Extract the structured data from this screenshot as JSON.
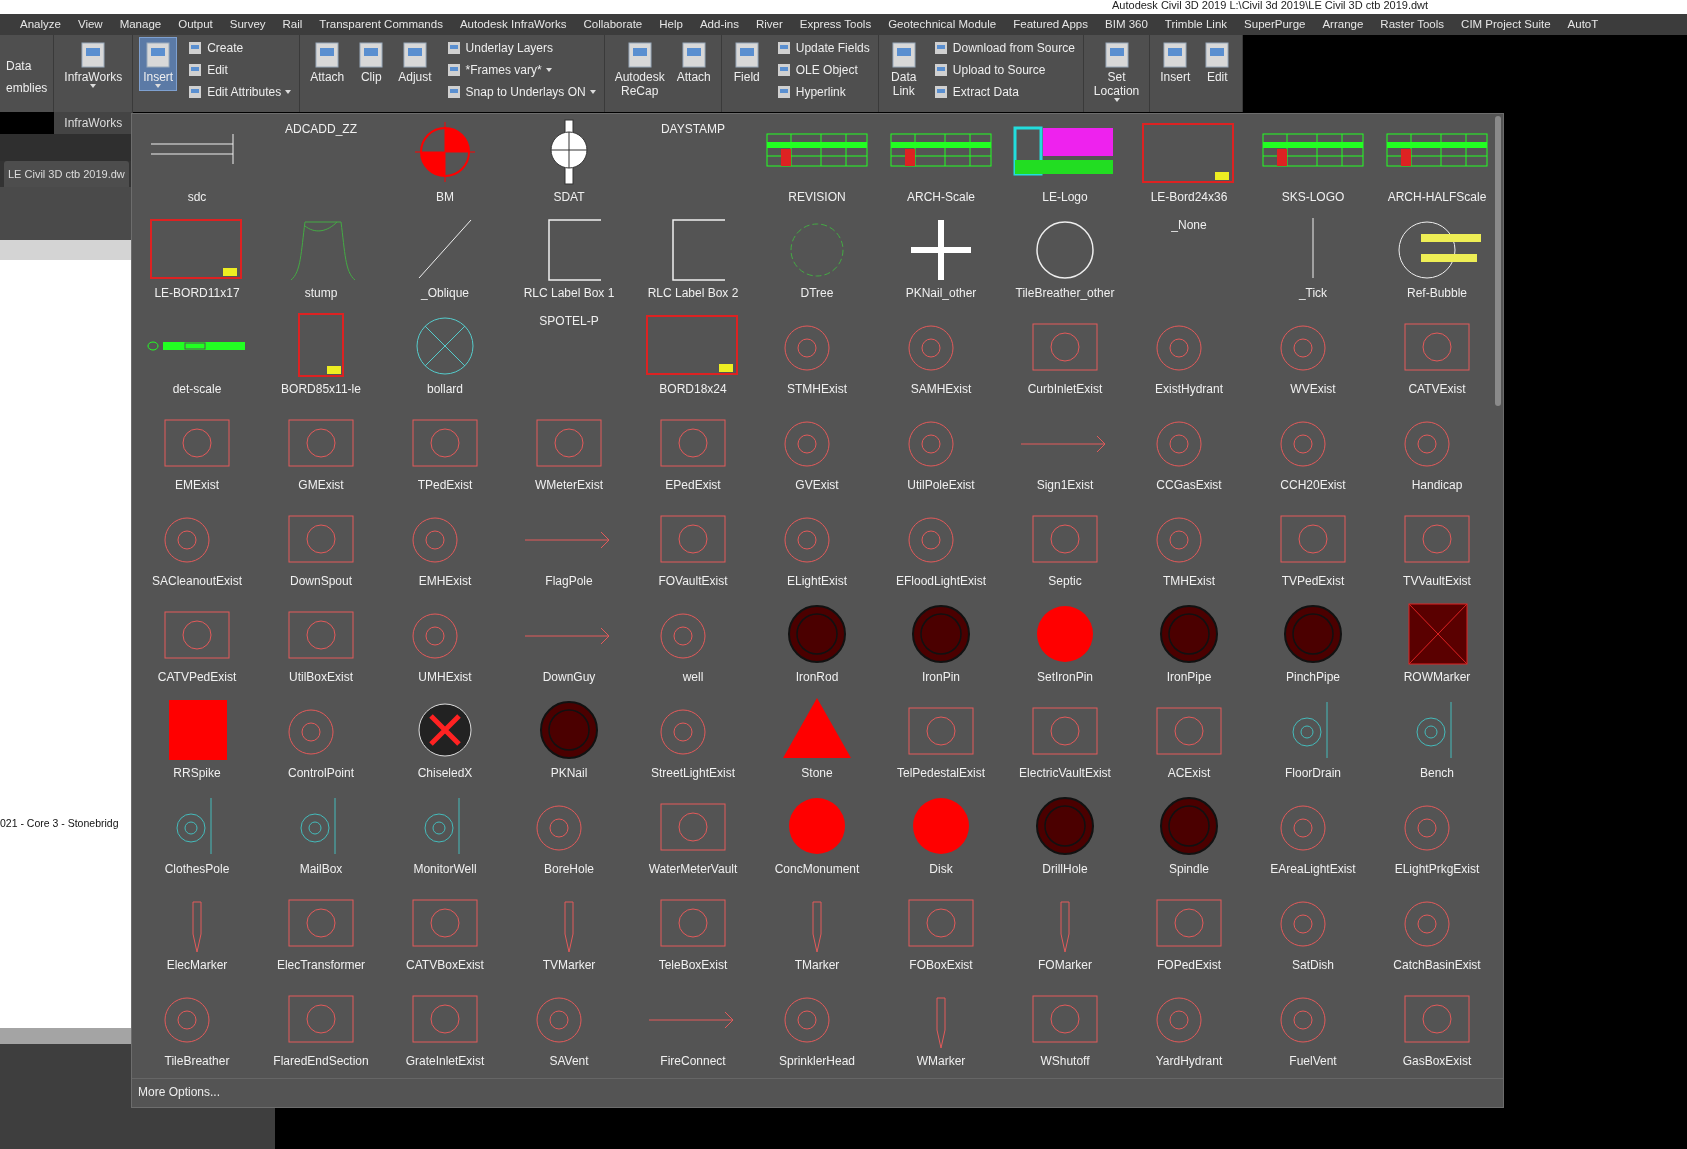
{
  "title_bar": {
    "title": "Autodesk Civil 3D 2019    L:\\Civil 3d 2019\\LE Civil 3D ctb 2019.dwt"
  },
  "ribbon_tabs": [
    "Analyze",
    "View",
    "Manage",
    "Output",
    "Survey",
    "Rail",
    "Transparent Commands",
    "Autodesk InfraWorks",
    "Collaborate",
    "Help",
    "Add-ins",
    "River",
    "Express Tools",
    "Geotechnical Module",
    "Featured Apps",
    "BIM 360",
    "Trimble Link",
    "SuperPurge",
    "Arrange",
    "Raster Tools",
    "CIM Project Suite",
    "AutoT"
  ],
  "ribbon_panels": [
    {
      "groups": [
        {
          "kind": "text",
          "items": [
            {
              "label": "Data"
            },
            {
              "label": "emblies"
            }
          ]
        }
      ]
    },
    {
      "label": "InfraWorks",
      "groups": [
        {
          "kind": "large",
          "items": [
            {
              "label": "InfraWorks",
              "dropdown": true,
              "open": false
            }
          ]
        }
      ]
    },
    {
      "groups": [
        {
          "kind": "large",
          "items": [
            {
              "label": "Insert",
              "dropdown": true,
              "open": true
            }
          ]
        },
        {
          "kind": "stack",
          "items": [
            {
              "label": "Create",
              "dropdown": false
            },
            {
              "label": "Edit",
              "dropdown": false
            },
            {
              "label": "Edit Attributes",
              "dropdown": true
            }
          ]
        }
      ]
    },
    {
      "groups": [
        {
          "kind": "large",
          "items": [
            {
              "label": "Attach",
              "dropdown": false,
              "open": false
            },
            {
              "label": "Clip",
              "dropdown": false,
              "open": false
            },
            {
              "label": "Adjust",
              "dropdown": false,
              "open": false
            }
          ]
        },
        {
          "kind": "stack",
          "items": [
            {
              "label": "Underlay Layers",
              "dropdown": false
            },
            {
              "label": "*Frames vary*",
              "dropdown": true
            },
            {
              "label": "Snap to Underlays ON",
              "dropdown": true
            }
          ]
        }
      ]
    },
    {
      "groups": [
        {
          "kind": "large",
          "items": [
            {
              "label": "Autodesk\nReCap",
              "dropdown": false,
              "open": false
            },
            {
              "label": "Attach",
              "dropdown": false,
              "open": false
            }
          ]
        }
      ]
    },
    {
      "groups": [
        {
          "kind": "large",
          "items": [
            {
              "label": "Field",
              "dropdown": false,
              "open": false
            }
          ]
        },
        {
          "kind": "stack",
          "items": [
            {
              "label": "Update Fields",
              "dropdown": false
            },
            {
              "label": "OLE Object",
              "dropdown": false
            },
            {
              "label": "Hyperlink",
              "dropdown": false
            }
          ]
        }
      ]
    },
    {
      "groups": [
        {
          "kind": "large",
          "items": [
            {
              "label": "Data\nLink",
              "dropdown": false,
              "open": false
            }
          ]
        },
        {
          "kind": "stack",
          "items": [
            {
              "label": "Download from Source",
              "dropdown": false
            },
            {
              "label": "Upload to Source",
              "dropdown": false
            },
            {
              "label": "Extract  Data",
              "dropdown": false
            }
          ]
        }
      ]
    },
    {
      "groups": [
        {
          "kind": "large",
          "items": [
            {
              "label": "Set\nLocation",
              "dropdown": true,
              "open": false
            }
          ]
        }
      ]
    },
    {
      "groups": [
        {
          "kind": "large",
          "items": [
            {
              "label": "Insert",
              "dropdown": false,
              "open": false
            },
            {
              "label": "Edit",
              "dropdown": false,
              "open": false
            }
          ]
        }
      ]
    }
  ],
  "document_tab": {
    "label": "LE Civil 3D ctb 2019.dw"
  },
  "drawing_text": "021 - Core 3 - Stonebridg",
  "gallery": {
    "blocks": [
      {
        "label": "sdc",
        "kind": "rule"
      },
      {
        "label": "ADCADD_ZZ",
        "kind": "none"
      },
      {
        "label": "BM",
        "kind": "target"
      },
      {
        "label": "SDAT",
        "kind": "survey"
      },
      {
        "label": "DAYSTAMP",
        "kind": "none"
      },
      {
        "label": "REVISION",
        "kind": "sheet"
      },
      {
        "label": "ARCH-Scale",
        "kind": "sheet"
      },
      {
        "label": "LE-Logo",
        "kind": "logo"
      },
      {
        "label": "LE-Bord24x36",
        "kind": "border"
      },
      {
        "label": "SKS-LOGO",
        "kind": "sheet"
      },
      {
        "label": "ARCH-HALFScale",
        "kind": "sheet"
      },
      {
        "label": "LE-BORD11x17",
        "kind": "border"
      },
      {
        "label": "stump",
        "kind": "stump"
      },
      {
        "label": "_Oblique",
        "kind": "slash"
      },
      {
        "label": "RLC Label Box 1",
        "kind": "bracket"
      },
      {
        "label": "RLC Label Box 2",
        "kind": "bracket"
      },
      {
        "label": "DTree",
        "kind": "tree"
      },
      {
        "label": "PKNail_other",
        "kind": "plus"
      },
      {
        "label": "TileBreather_other",
        "kind": "ring"
      },
      {
        "label": "_None",
        "kind": "none"
      },
      {
        "label": "_Tick",
        "kind": "tick"
      },
      {
        "label": "Ref-Bubble",
        "kind": "bubble"
      },
      {
        "label": "det-scale",
        "kind": "scale"
      },
      {
        "label": "BORD85x11-le",
        "kind": "portrait"
      },
      {
        "label": "bollard",
        "kind": "xcircle"
      },
      {
        "label": "SPOTEL-P",
        "kind": "none"
      },
      {
        "label": "BORD18x24",
        "kind": "border"
      },
      {
        "label": "STMHExist",
        "kind": "ocircle"
      },
      {
        "label": "SAMHExist",
        "kind": "ocircle"
      },
      {
        "label": "CurbInletExist",
        "kind": "obox"
      },
      {
        "label": "ExistHydrant",
        "kind": "ocircle"
      },
      {
        "label": "WVExist",
        "kind": "ocircle"
      },
      {
        "label": "CATVExist",
        "kind": "obox"
      },
      {
        "label": "EMExist",
        "kind": "obox"
      },
      {
        "label": "GMExist",
        "kind": "obox"
      },
      {
        "label": "TPedExist",
        "kind": "obox"
      },
      {
        "label": "WMeterExist",
        "kind": "obox"
      },
      {
        "label": "EPedExist",
        "kind": "obox"
      },
      {
        "label": "GVExist",
        "kind": "ocircle"
      },
      {
        "label": "UtilPoleExist",
        "kind": "ocircle"
      },
      {
        "label": "Sign1Exist",
        "kind": "line"
      },
      {
        "label": "CCGasExist",
        "kind": "ocircle"
      },
      {
        "label": "CCH20Exist",
        "kind": "ocircle"
      },
      {
        "label": "Handicap",
        "kind": "ocircle"
      },
      {
        "label": "SACleanoutExist",
        "kind": "ocircle"
      },
      {
        "label": "DownSpout",
        "kind": "obox"
      },
      {
        "label": "EMHExist",
        "kind": "ocircle"
      },
      {
        "label": "FlagPole",
        "kind": "line"
      },
      {
        "label": "FOVaultExist",
        "kind": "obox"
      },
      {
        "label": "ELightExist",
        "kind": "ocircle"
      },
      {
        "label": "EFloodLightExist",
        "kind": "ocircle"
      },
      {
        "label": "Septic",
        "kind": "obox"
      },
      {
        "label": "TMHExist",
        "kind": "ocircle"
      },
      {
        "label": "TVPedExist",
        "kind": "obox"
      },
      {
        "label": "TVVaultExist",
        "kind": "obox"
      },
      {
        "label": "CATVPedExist",
        "kind": "obox"
      },
      {
        "label": "UtilBoxExist",
        "kind": "obox"
      },
      {
        "label": "UMHExist",
        "kind": "ocircle"
      },
      {
        "label": "DownGuy",
        "kind": "line"
      },
      {
        "label": "well",
        "kind": "ocircle"
      },
      {
        "label": "IronRod",
        "kind": "dark"
      },
      {
        "label": "IronPin",
        "kind": "dark"
      },
      {
        "label": "SetIronPin",
        "kind": "solid"
      },
      {
        "label": "IronPipe",
        "kind": "dark"
      },
      {
        "label": "PinchPipe",
        "kind": "dark"
      },
      {
        "label": "ROWMarker",
        "kind": "xsquare"
      },
      {
        "label": "RRSpike",
        "kind": "square"
      },
      {
        "label": "ControlPoint",
        "kind": "ocircle"
      },
      {
        "label": "ChiseledX",
        "kind": "chisel"
      },
      {
        "label": "PKNail",
        "kind": "dark"
      },
      {
        "label": "StreetLightExist",
        "kind": "ocircle"
      },
      {
        "label": "Stone",
        "kind": "triangle"
      },
      {
        "label": "TelPedestalExist",
        "kind": "obox"
      },
      {
        "label": "ElectricVaultExist",
        "kind": "obox"
      },
      {
        "label": "ACExist",
        "kind": "obox"
      },
      {
        "label": "FloorDrain",
        "kind": "teal"
      },
      {
        "label": "Bench",
        "kind": "teal"
      },
      {
        "label": "ClothesPole",
        "kind": "teal"
      },
      {
        "label": "MailBox",
        "kind": "teal"
      },
      {
        "label": "MonitorWell",
        "kind": "teal"
      },
      {
        "label": "BoreHole",
        "kind": "ocircle"
      },
      {
        "label": "WaterMeterVault",
        "kind": "obox"
      },
      {
        "label": "ConcMonument",
        "kind": "solid"
      },
      {
        "label": "Disk",
        "kind": "solid"
      },
      {
        "label": "DrillHole",
        "kind": "dark"
      },
      {
        "label": "Spindle",
        "kind": "dark"
      },
      {
        "label": "EAreaLightExist",
        "kind": "ocircle"
      },
      {
        "label": "ELightPrkgExist",
        "kind": "ocircle"
      },
      {
        "label": "ElecMarker",
        "kind": "marker"
      },
      {
        "label": "ElecTransformer",
        "kind": "obox"
      },
      {
        "label": "CATVBoxExist",
        "kind": "obox"
      },
      {
        "label": "TVMarker",
        "kind": "marker"
      },
      {
        "label": "TeleBoxExist",
        "kind": "obox"
      },
      {
        "label": "TMarker",
        "kind": "marker"
      },
      {
        "label": "FOBoxExist",
        "kind": "obox"
      },
      {
        "label": "FOMarker",
        "kind": "marker"
      },
      {
        "label": "FOPedExist",
        "kind": "obox"
      },
      {
        "label": "SatDish",
        "kind": "ocircle"
      },
      {
        "label": "CatchBasinExist",
        "kind": "ocircle"
      },
      {
        "label": "TileBreather",
        "kind": "ocircle"
      },
      {
        "label": "FlaredEndSection",
        "kind": "obox"
      },
      {
        "label": "GrateInletExist",
        "kind": "obox"
      },
      {
        "label": "SAVent",
        "kind": "ocircle"
      },
      {
        "label": "FireConnect",
        "kind": "line"
      },
      {
        "label": "SprinklerHead",
        "kind": "ocircle"
      },
      {
        "label": "WMarker",
        "kind": "marker"
      },
      {
        "label": "WShutoff",
        "kind": "obox"
      },
      {
        "label": "YardHydrant",
        "kind": "ocircle"
      },
      {
        "label": "FuelVent",
        "kind": "ocircle"
      },
      {
        "label": "GasBoxExist",
        "kind": "obox"
      }
    ],
    "more_options": "More Options..."
  }
}
